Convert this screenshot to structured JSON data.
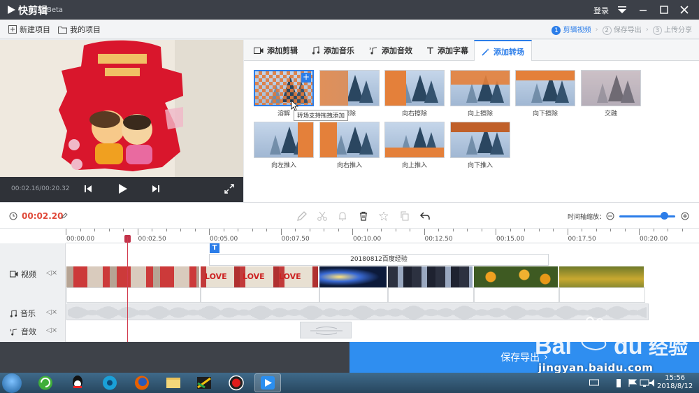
{
  "titlebar": {
    "app_name": "快剪辑",
    "beta": "Beta",
    "login": "登录"
  },
  "toolbar": {
    "new_project": "新建项目",
    "my_projects": "我的项目",
    "steps": [
      {
        "num": "1",
        "label": "剪辑视频"
      },
      {
        "num": "2",
        "label": "保存导出"
      },
      {
        "num": "3",
        "label": "上传分享"
      }
    ]
  },
  "preview": {
    "time": "00:02.16/00:20.32"
  },
  "tabs": [
    {
      "label": "添加剪辑"
    },
    {
      "label": "添加音乐"
    },
    {
      "label": "添加音效"
    },
    {
      "label": "添加字幕"
    },
    {
      "label": "添加转场"
    }
  ],
  "transitions": [
    {
      "label": "溶解"
    },
    {
      "label": "擦除"
    },
    {
      "label": "向右擦除"
    },
    {
      "label": "向上擦除"
    },
    {
      "label": "向下擦除"
    },
    {
      "label": "交融"
    },
    {
      "label": "向左推入"
    },
    {
      "label": "向右推入"
    },
    {
      "label": "向上推入"
    },
    {
      "label": "向下推入"
    }
  ],
  "tooltip": "转场支持拖拽添加",
  "edit_bar": {
    "current_time": "00:02.20",
    "zoom_label": "时间轴缩放：",
    "zoom_level": 0.8
  },
  "timeline": {
    "ticks": [
      "00:00.00",
      "00:02.50",
      "00:05.00",
      "00:07.50",
      "00:10.00",
      "00:12.50",
      "00:15.00",
      "00:17.50",
      "00:20.00"
    ],
    "tracks": {
      "video": "视频",
      "music": "音乐",
      "sfx": "音效"
    },
    "subtitle_text": "20180812百度经验"
  },
  "bottom": {
    "save_label": "保存导出"
  },
  "watermark": {
    "text": "jingyan.baidu.com"
  },
  "taskbar": {
    "time": "15:56",
    "date": "2018/8/12"
  },
  "colors": {
    "accent": "#2b7de9",
    "playhead": "#d23c4e",
    "current_time": "#e04a3a",
    "save_button": "#2f8ef0"
  }
}
